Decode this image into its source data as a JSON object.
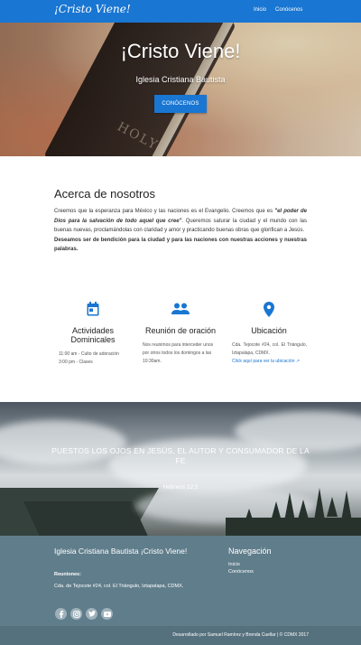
{
  "nav": {
    "brand": "¡Cristo Viene!",
    "links": [
      "Inicio",
      "Conócenos"
    ]
  },
  "hero": {
    "title": "¡Cristo Viene!",
    "subtitle": "Iglesia Cristiana Bautista",
    "button": "CONÓCENOS",
    "book_text": "HOLY"
  },
  "about": {
    "title": "Acerca de nosotros",
    "p1_start": "Creemos que la esperanza para México y las naciones es el Evangelio. Creemos que es ",
    "p1_quote": "\"el poder de Dios para la salvación de todo aquel que cree\"",
    "p1_end": ". Queremos saturar la ciudad y el mundo con las buenas nuevas, proclamándolas con claridad y amor y practicando buenas obras que glorifican a Jesús.",
    "p2": "Deseamos ser de bendición para la ciudad y para las naciones con nuestras acciones y nuestras palabras."
  },
  "features": [
    {
      "icon": "calendar-icon",
      "title": "Actividades Dominicales",
      "lines": [
        "11:00 am - Culto de adoración",
        "3:00 pm - Clases"
      ]
    },
    {
      "icon": "people-icon",
      "title": "Reunión de oración",
      "text": "Nos reunimos para interceder unos por otros todos los domingos a las 10:30am."
    },
    {
      "icon": "location-pin-icon",
      "title": "Ubicación",
      "text": "Cda. Tejocote #24, col. El Triángulo, Iztapalapa, CDMX.",
      "link": "Click aquí para ver la ubicación"
    }
  ],
  "verse": {
    "text": "PUESTOS LOS OJOS EN JESÚS, EL AUTOR Y CONSUMADOR DE LA FE",
    "ref": "Hebreos 12:2"
  },
  "footer": {
    "title": "Iglesia Cristiana Bautista ¡Cristo Viene!",
    "label": "Reuniones:",
    "address": "Cda. de Tejocote #24, col. El Triángulo, Iztapalapa, CDMX.",
    "social": [
      "facebook-icon",
      "instagram-icon",
      "twitter-icon",
      "youtube-icon"
    ],
    "nav_title": "Navegación",
    "links": [
      "Inicio",
      "Conócenos"
    ],
    "credits": "Desarrollado por Samuel Ramírez y Brenda Cuellar | © CDMX 2017"
  },
  "colors": {
    "primary": "#1976d2",
    "footer": "#607d8b",
    "footer_bottom": "#56717e"
  }
}
